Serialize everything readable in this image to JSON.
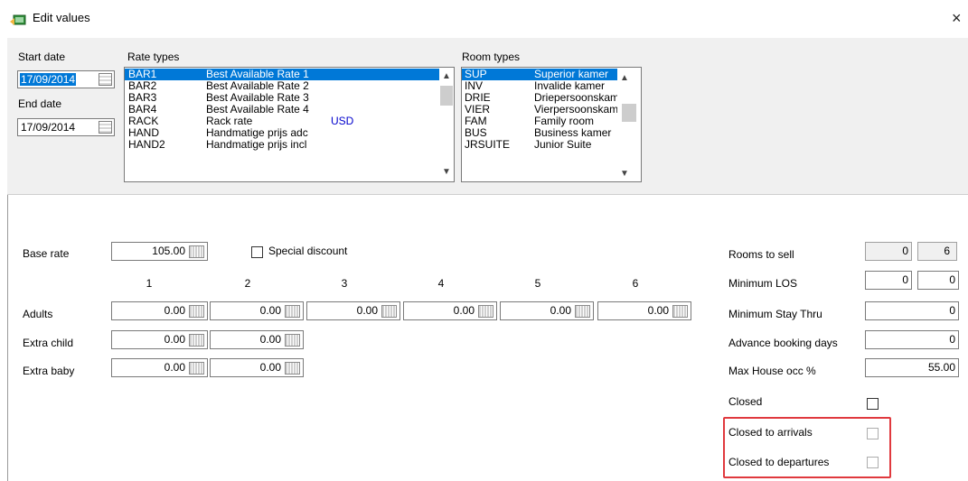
{
  "window": {
    "title": "Edit values",
    "close_label": "×"
  },
  "dates": {
    "start_label": "Start date",
    "start_value": "17/09/2014",
    "end_label": "End date",
    "end_value": "17/09/2014"
  },
  "rate_types": {
    "label": "Rate types",
    "rows": [
      {
        "code": "BAR1",
        "name": "Best Available Rate 1",
        "currency": ""
      },
      {
        "code": "BAR2",
        "name": "Best Available Rate 2",
        "currency": ""
      },
      {
        "code": "BAR3",
        "name": "Best Available Rate 3",
        "currency": ""
      },
      {
        "code": "BAR4",
        "name": "Best Available Rate 4",
        "currency": ""
      },
      {
        "code": "RACK",
        "name": "Rack rate",
        "currency": "USD"
      },
      {
        "code": "HAND",
        "name": "Handmatige prijs adc",
        "currency": ""
      },
      {
        "code": "HAND2",
        "name": "Handmatige prijs incl",
        "currency": ""
      }
    ]
  },
  "room_types": {
    "label": "Room types",
    "rows": [
      {
        "code": "SUP",
        "name": "Superior kamer"
      },
      {
        "code": "INV",
        "name": "Invalide kamer"
      },
      {
        "code": "DRIE",
        "name": "Driepersoonskamer"
      },
      {
        "code": "VIER",
        "name": "Vierpersoonskamer"
      },
      {
        "code": "FAM",
        "name": "Family room"
      },
      {
        "code": "BUS",
        "name": "Business kamer"
      },
      {
        "code": "JRSUITE",
        "name": "Junior Suite"
      }
    ]
  },
  "rates": {
    "base_rate_label": "Base rate",
    "base_rate_value": "105.00",
    "special_discount_label": "Special discount",
    "columns": [
      "1",
      "2",
      "3",
      "4",
      "5",
      "6"
    ],
    "adults_label": "Adults",
    "adults_values": [
      "0.00",
      "0.00",
      "0.00",
      "0.00",
      "0.00",
      "0.00"
    ],
    "extra_child_label": "Extra child",
    "extra_child_values": [
      "0.00",
      "0.00"
    ],
    "extra_baby_label": "Extra baby",
    "extra_baby_values": [
      "0.00",
      "0.00"
    ]
  },
  "restrictions": {
    "rooms_to_sell_label": "Rooms to sell",
    "rooms_to_sell_values": [
      "0",
      "6"
    ],
    "min_los_label": "Minimum LOS",
    "min_los_values": [
      "0",
      "0"
    ],
    "min_stay_thru_label": "Minimum Stay Thru",
    "min_stay_thru_value": "0",
    "advance_booking_label": "Advance booking days",
    "advance_booking_value": "0",
    "max_house_label": "Max House occ %",
    "max_house_value": "55.00",
    "closed_label": "Closed",
    "closed_arrivals_label": "Closed to arrivals",
    "closed_departures_label": "Closed to departures"
  },
  "colors": {
    "selection": "#0078d7",
    "highlight": "#e0393e",
    "panel": "#f0f0f0",
    "currency": "#0000cc"
  }
}
